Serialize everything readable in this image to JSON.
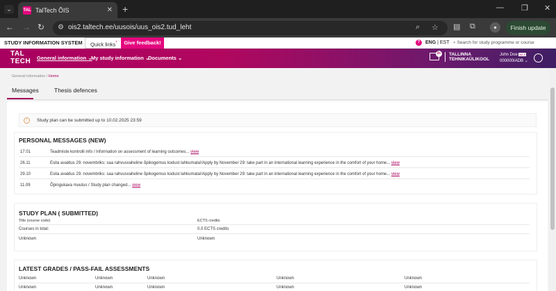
{
  "browser": {
    "tab_title": "TalTech ÕIS",
    "url": "ois2.taltech.ee/uusois/uus_ois2.tud_leht",
    "finish_update": "Finish update",
    "favicon_text": "TAL"
  },
  "topbar": {
    "system_title": "STUDY INFORMATION SYSTEM",
    "quick_links": "Quick links",
    "quick_links_mark": "*",
    "give_feedback": "Give feedback!",
    "lang_eng": "ENG",
    "lang_sep": " | ",
    "lang_est": "EST",
    "search_placeholder": "Search for study programme or course"
  },
  "header": {
    "logo_line1": "TAL",
    "logo_line2": "TECH",
    "menu": [
      "General information",
      "My study information",
      "Documents"
    ],
    "mail_badge": "3+",
    "ttu_line1": "TALLINNA",
    "ttu_line2": "TEHNIKAÜLIKOOL",
    "user_name": "John Doe",
    "user_code": "000000IADB",
    "user_role_badge": "BA E"
  },
  "breadcrumb": {
    "first": "General information",
    "sep": " / ",
    "current": "Home"
  },
  "tabs": [
    "Messages",
    "Thesis defences"
  ],
  "notice": "Study plan can be submitted up to 10.02.2025 23:59",
  "personal_messages": {
    "title": "PERSONAL MESSAGES (NEW)",
    "view_label": "view",
    "items": [
      {
        "date": "17.01",
        "text": "Teadmiste kontrolli info / Information on assessment of learning outcomes..."
      },
      {
        "date": "26.11",
        "text": "Esita avaldus 29. novembriks: saa rahvusvaheline õpikogemus kodust lahkumata!/Apply by November 29: take part in an international learning experience in the comfort of your home..."
      },
      {
        "date": "29.10",
        "text": "Esita avaldus 29. novembriks: saa rahvusvaheline õpikogemus kodust lahkumata!/Apply by November 29: take part in an international learning experience in the comfort of your home..."
      },
      {
        "date": "11.09",
        "text": "Õpingukava muutus / Study plan changed..."
      }
    ]
  },
  "study_plan": {
    "title": "STUDY PLAN ( SUBMITTED)",
    "col_title": "Title (course code)",
    "col_ects": "ECTS credits",
    "total_label": "Courses in total:",
    "total_value": "0.0 ECTS credits",
    "row_title": "Unknown",
    "row_ects": "Unknown"
  },
  "grades": {
    "title": "LATEST GRADES / PASS-FAIL ASSESSMENTS",
    "rows": [
      [
        "Unknown",
        "Unknown",
        "Unknown",
        "Unknown",
        "Unknown"
      ],
      [
        "Unknown",
        "Unknown",
        "Unknown",
        "Unknown",
        "Unknown"
      ]
    ]
  },
  "colors": {
    "brand": "#e4067e",
    "header_start": "#a8005f",
    "header_end": "#3f1f64"
  }
}
